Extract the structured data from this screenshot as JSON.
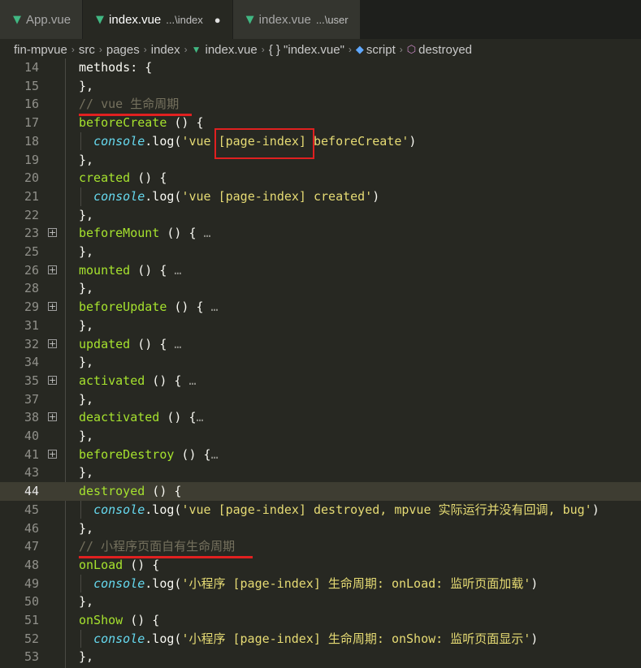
{
  "tabs": [
    {
      "label": "App.vue",
      "hint": "",
      "dirty": false,
      "active": false
    },
    {
      "label": "index.vue",
      "hint": "...\\index",
      "dirty": true,
      "active": true
    },
    {
      "label": "index.vue",
      "hint": "...\\user",
      "dirty": false,
      "active": false
    }
  ],
  "breadcrumb": [
    "fin-mpvue",
    "src",
    "pages",
    "index",
    "index.vue",
    "{ } \"index.vue\"",
    "script",
    "destroyed"
  ],
  "current_line": 44,
  "lines": [
    {
      "n": 14,
      "t": "methods: {"
    },
    {
      "n": 15,
      "t": "},"
    },
    {
      "n": 16,
      "t": "// vue 生命周期"
    },
    {
      "n": 17,
      "t": "beforeCreate () {"
    },
    {
      "n": 18,
      "t": "  console.log('vue [page-index] beforeCreate')"
    },
    {
      "n": 19,
      "t": "},"
    },
    {
      "n": 20,
      "t": "created () {"
    },
    {
      "n": 21,
      "t": "  console.log('vue [page-index] created')"
    },
    {
      "n": 22,
      "t": "},"
    },
    {
      "n": 23,
      "t": "beforeMount () { …",
      "fold": true
    },
    {
      "n": 25,
      "t": "},"
    },
    {
      "n": 26,
      "t": "mounted () { …",
      "fold": true
    },
    {
      "n": 28,
      "t": "},"
    },
    {
      "n": 29,
      "t": "beforeUpdate () { …",
      "fold": true
    },
    {
      "n": 31,
      "t": "},"
    },
    {
      "n": 32,
      "t": "updated () { …",
      "fold": true
    },
    {
      "n": 34,
      "t": "},"
    },
    {
      "n": 35,
      "t": "activated () { …",
      "fold": true
    },
    {
      "n": 37,
      "t": "},"
    },
    {
      "n": 38,
      "t": "deactivated () {…",
      "fold": true
    },
    {
      "n": 40,
      "t": "},"
    },
    {
      "n": 41,
      "t": "beforeDestroy () {…",
      "fold": true
    },
    {
      "n": 43,
      "t": "},"
    },
    {
      "n": 44,
      "t": "destroyed () {"
    },
    {
      "n": 45,
      "t": "  console.log('vue [page-index] destroyed, mpvue 实际运行并没有回调, bug')"
    },
    {
      "n": 46,
      "t": "},"
    },
    {
      "n": 47,
      "t": "// 小程序页面自有生命周期"
    },
    {
      "n": 48,
      "t": "onLoad () {"
    },
    {
      "n": 49,
      "t": "  console.log('小程序 [page-index] 生命周期: onLoad: 监听页面加载')"
    },
    {
      "n": 50,
      "t": "},"
    },
    {
      "n": 51,
      "t": "onShow () {"
    },
    {
      "n": 52,
      "t": "  console.log('小程序 [page-index] 生命周期: onShow: 监听页面显示')"
    },
    {
      "n": 53,
      "t": "},"
    }
  ],
  "colors": {
    "bg": "#272822",
    "function": "#a6e22e",
    "console": "#66d9ef",
    "string": "#e6db74",
    "comment": "#75715e",
    "annotation": "#e02020"
  }
}
